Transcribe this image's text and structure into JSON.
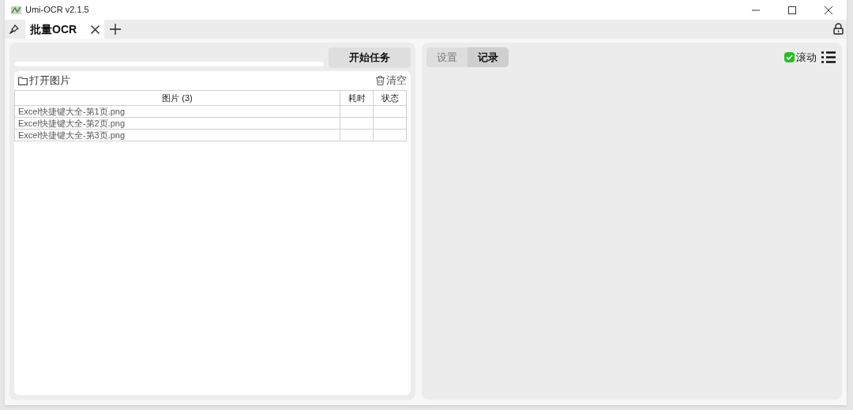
{
  "window": {
    "title": "Umi-OCR v2.1.5"
  },
  "tabs": [
    {
      "label": "批量OCR",
      "selected": true
    }
  ],
  "left": {
    "start_button": "开始任务",
    "open_button": "打开图片",
    "clear_button": "清空",
    "table": {
      "columns": [
        "图片 (3)",
        "耗时",
        "状态"
      ],
      "rows": [
        [
          "Excel快捷键大全-第1页.png",
          "",
          ""
        ],
        [
          "Excel快捷键大全-第2页.png",
          "",
          ""
        ],
        [
          "Excel快捷键大全-第3页.png",
          "",
          ""
        ]
      ]
    }
  },
  "right": {
    "tabs": [
      {
        "label": "设置",
        "selected": false
      },
      {
        "label": "记录",
        "selected": true
      }
    ],
    "scroll": {
      "label": "滚动",
      "checked": true
    }
  }
}
